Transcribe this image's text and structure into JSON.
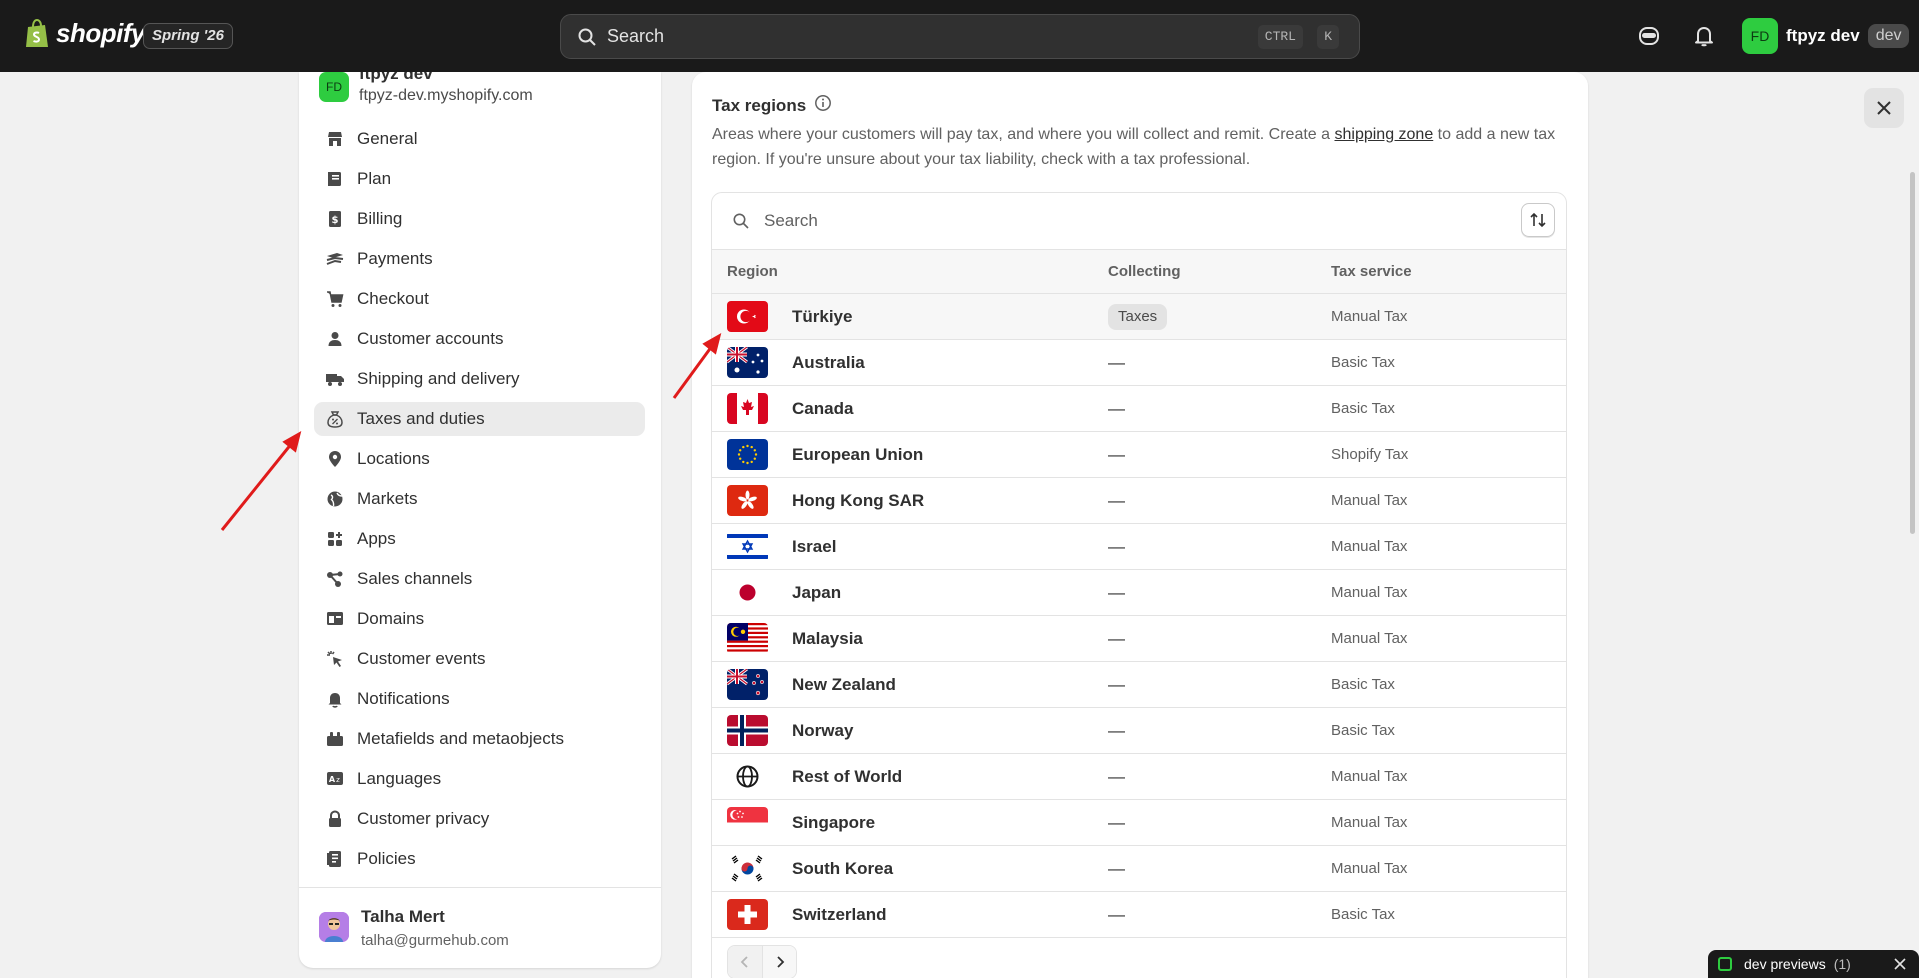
{
  "topbar": {
    "logo_text": "shopify",
    "edition": "Spring '26",
    "search_placeholder": "Search",
    "kbd_ctrl": "CTRL",
    "kbd_k": "K",
    "account_initials": "FD",
    "account_name": "ftpyz dev",
    "account_badge": "dev"
  },
  "sidebar": {
    "store_initials": "FD",
    "store_name": "ftpyz dev",
    "store_url": "ftpyz-dev.myshopify.com",
    "items": [
      {
        "label": "General",
        "icon": "store-icon"
      },
      {
        "label": "Plan",
        "icon": "plan-icon"
      },
      {
        "label": "Billing",
        "icon": "billing-icon"
      },
      {
        "label": "Payments",
        "icon": "payments-icon"
      },
      {
        "label": "Checkout",
        "icon": "cart-icon"
      },
      {
        "label": "Customer accounts",
        "icon": "person-icon"
      },
      {
        "label": "Shipping and delivery",
        "icon": "truck-icon"
      },
      {
        "label": "Taxes and duties",
        "icon": "tax-icon"
      },
      {
        "label": "Locations",
        "icon": "location-icon"
      },
      {
        "label": "Markets",
        "icon": "globe-icon"
      },
      {
        "label": "Apps",
        "icon": "apps-icon"
      },
      {
        "label": "Sales channels",
        "icon": "channels-icon"
      },
      {
        "label": "Domains",
        "icon": "domains-icon"
      },
      {
        "label": "Customer events",
        "icon": "cursor-icon"
      },
      {
        "label": "Notifications",
        "icon": "bell-icon"
      },
      {
        "label": "Metafields and metaobjects",
        "icon": "metafields-icon"
      },
      {
        "label": "Languages",
        "icon": "languages-icon"
      },
      {
        "label": "Customer privacy",
        "icon": "lock-icon"
      },
      {
        "label": "Policies",
        "icon": "policies-icon"
      }
    ],
    "active_index": 7,
    "user_name": "Talha Mert",
    "user_email": "talha@gurmehub.com"
  },
  "tax_regions": {
    "title": "Tax regions",
    "desc_before": "Areas where your customers will pay tax, and where you will collect and remit. Create a ",
    "desc_link": "shipping zone",
    "desc_after": " to add a new tax region. If you're unsure about your tax liability, check with a tax professional.",
    "search_placeholder": "Search",
    "columns": [
      "Region",
      "Collecting",
      "Tax service"
    ],
    "rows": [
      {
        "region": "Türkiye",
        "collecting": "Taxes",
        "service": "Manual Tax",
        "flag": "tr"
      },
      {
        "region": "Australia",
        "collecting": "—",
        "service": "Basic Tax",
        "flag": "au"
      },
      {
        "region": "Canada",
        "collecting": "—",
        "service": "Basic Tax",
        "flag": "ca"
      },
      {
        "region": "European Union",
        "collecting": "—",
        "service": "Shopify Tax",
        "flag": "eu"
      },
      {
        "region": "Hong Kong SAR",
        "collecting": "—",
        "service": "Manual Tax",
        "flag": "hk"
      },
      {
        "region": "Israel",
        "collecting": "—",
        "service": "Manual Tax",
        "flag": "il"
      },
      {
        "region": "Japan",
        "collecting": "—",
        "service": "Manual Tax",
        "flag": "jp"
      },
      {
        "region": "Malaysia",
        "collecting": "—",
        "service": "Manual Tax",
        "flag": "my"
      },
      {
        "region": "New Zealand",
        "collecting": "—",
        "service": "Basic Tax",
        "flag": "nz"
      },
      {
        "region": "Norway",
        "collecting": "—",
        "service": "Basic Tax",
        "flag": "no"
      },
      {
        "region": "Rest of World",
        "collecting": "—",
        "service": "Manual Tax",
        "flag": "world"
      },
      {
        "region": "Singapore",
        "collecting": "—",
        "service": "Manual Tax",
        "flag": "sg"
      },
      {
        "region": "South Korea",
        "collecting": "—",
        "service": "Manual Tax",
        "flag": "kr"
      },
      {
        "region": "Switzerland",
        "collecting": "—",
        "service": "Basic Tax",
        "flag": "ch"
      }
    ]
  },
  "dev_previews": {
    "label": "dev previews",
    "count": "(1)"
  },
  "colors": {
    "topbar": "#1a1a1a",
    "accent_green": "#2ecc40",
    "annotation_red": "#e01b1b"
  }
}
